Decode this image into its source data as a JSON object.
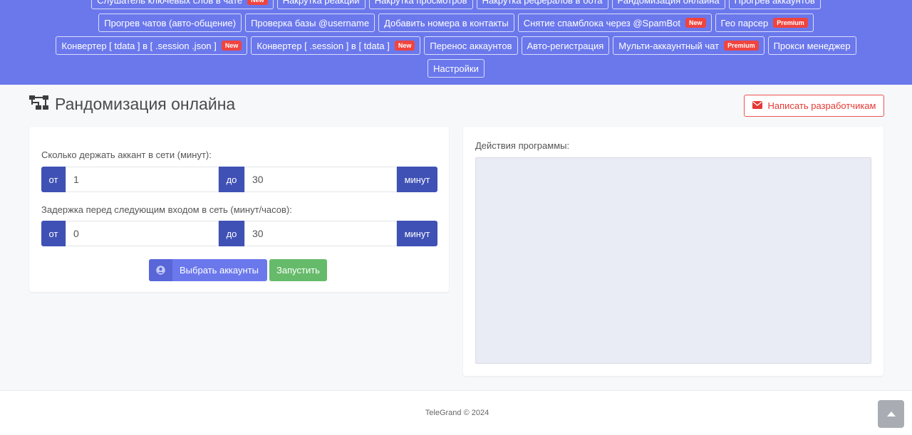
{
  "nav": {
    "rows": [
      [
        {
          "label": "Слушатель ключевых слов в чате",
          "badge": "New"
        },
        {
          "label": "Накрутка реакций",
          "badge": ""
        },
        {
          "label": "Накрутка просмотров",
          "badge": ""
        },
        {
          "label": "Накрутка рефералов в бота",
          "badge": ""
        },
        {
          "label": "Рандомизация онлайна",
          "badge": ""
        },
        {
          "label": "Прогрев аккаунтов",
          "badge": ""
        }
      ],
      [
        {
          "label": "Прогрев чатов (авто-общение)",
          "badge": ""
        },
        {
          "label": "Проверка базы @username",
          "badge": ""
        },
        {
          "label": "Добавить номера в контакты",
          "badge": ""
        },
        {
          "label": "Снятие спамблока через @SpamBot",
          "badge": "New"
        },
        {
          "label": "Гео парсер",
          "badge": "Premium"
        }
      ],
      [
        {
          "label": "Конвертер [ tdata ] в [ .session .json ]",
          "badge": "New"
        },
        {
          "label": "Конвертер [ .session ] в [ tdata ]",
          "badge": "New"
        },
        {
          "label": "Перенос аккаунтов",
          "badge": ""
        },
        {
          "label": "Авто-регистрация",
          "badge": ""
        },
        {
          "label": "Мульти-аккаунтный чат",
          "badge": "Premium"
        },
        {
          "label": "Прокси менеджер",
          "badge": ""
        }
      ],
      [
        {
          "label": "Настройки",
          "badge": ""
        }
      ]
    ]
  },
  "page": {
    "title": "Рандомизация онлайна",
    "title_icon": "sitemap-icon",
    "contact_button": "Написать разработчикам",
    "contact_icon": "envelope-icon"
  },
  "form": {
    "online_label": "Сколько держать аккант в сети (минут):",
    "online_from_prefix": "от",
    "online_from_value": "1",
    "online_to_prefix": "до",
    "online_to_value": "30",
    "online_unit": "минут",
    "delay_label": "Задержка перед следующим входом в сеть (минут/часов):",
    "delay_from_prefix": "от",
    "delay_from_value": "0",
    "delay_to_prefix": "до",
    "delay_to_value": "30",
    "delay_unit": "минут",
    "select_accounts_button": "Выбрать аккаунты",
    "select_accounts_icon": "user-circle-icon",
    "start_button": "Запустить"
  },
  "log": {
    "label": "Действия программы:",
    "content": ""
  },
  "footer": {
    "text": "TeleGrand © 2024",
    "scroll_icon": "chevron-up-icon"
  },
  "colors": {
    "nav_bg": "#6b78ec",
    "addon_bg": "#3f51b5",
    "badge_bg": "#f0443f",
    "start_bg": "#66bb6a",
    "danger": "#e53935"
  }
}
